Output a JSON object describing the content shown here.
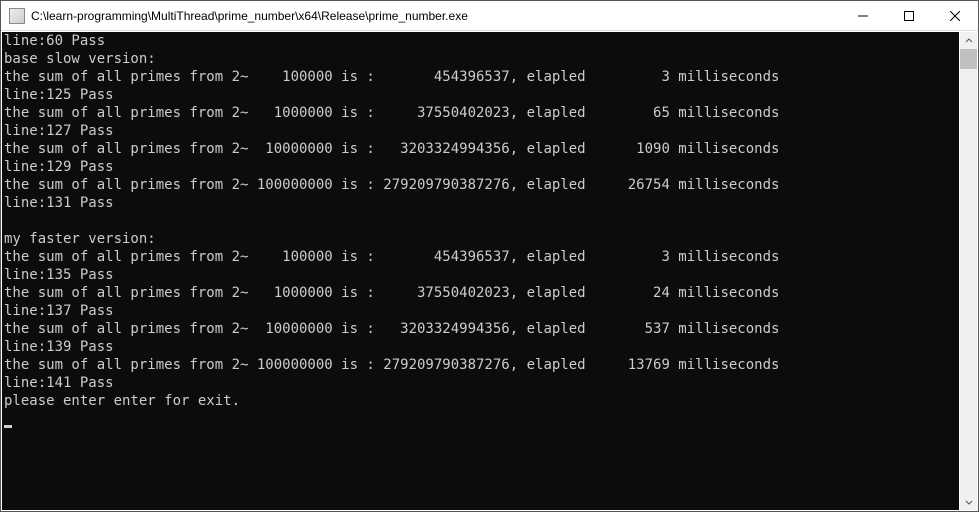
{
  "window": {
    "title": "C:\\learn-programming\\MultiThread\\prime_number\\x64\\Release\\prime_number.exe"
  },
  "console": {
    "lines": [
      "line:60 Pass",
      "base slow version:",
      "the sum of all primes from 2~    100000 is :       454396537, elapled         3 milliseconds",
      "line:125 Pass",
      "the sum of all primes from 2~   1000000 is :     37550402023, elapled        65 milliseconds",
      "line:127 Pass",
      "the sum of all primes from 2~  10000000 is :   3203324994356, elapled      1090 milliseconds",
      "line:129 Pass",
      "the sum of all primes from 2~ 100000000 is : 279209790387276, elapled     26754 milliseconds",
      "line:131 Pass",
      "",
      "my faster version:",
      "the sum of all primes from 2~    100000 is :       454396537, elapled         3 milliseconds",
      "line:135 Pass",
      "the sum of all primes from 2~   1000000 is :     37550402023, elapled        24 milliseconds",
      "line:137 Pass",
      "the sum of all primes from 2~  10000000 is :   3203324994356, elapled       537 milliseconds",
      "line:139 Pass",
      "the sum of all primes from 2~ 100000000 is : 279209790387276, elapled     13769 milliseconds",
      "line:141 Pass",
      "please enter enter for exit."
    ]
  }
}
